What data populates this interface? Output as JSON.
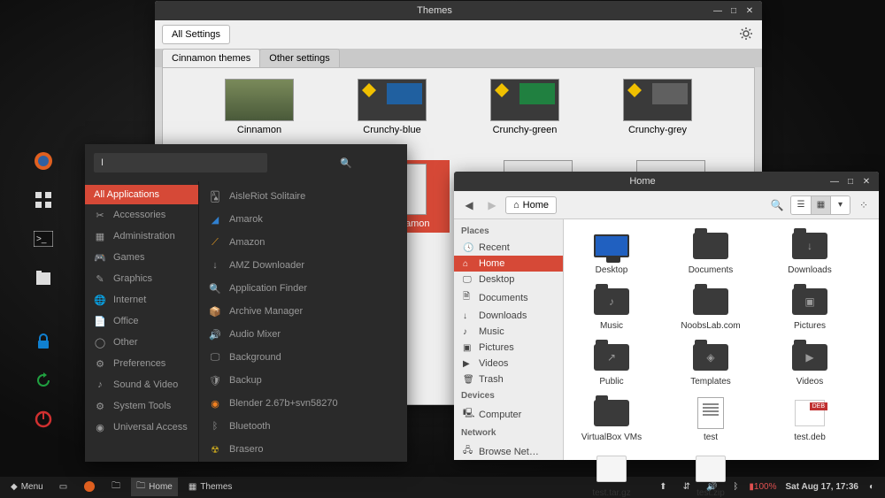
{
  "themes_window": {
    "title": "Themes",
    "all_settings": "All Settings",
    "tab_cinnamon": "Cinnamon themes",
    "tab_other": "Other settings",
    "items": [
      "Cinnamon",
      "Crunchy-blue",
      "Crunchy-green",
      "Crunchy-grey",
      "",
      "Numix-Cinnamon",
      "",
      ""
    ]
  },
  "menu": {
    "search_value": "I",
    "all_apps": "All Applications",
    "categories": [
      "Accessories",
      "Administration",
      "Games",
      "Graphics",
      "Internet",
      "Office",
      "Other",
      "Preferences",
      "Sound & Video",
      "System Tools",
      "Universal Access"
    ],
    "apps": [
      "AisleRiot Solitaire",
      "Amarok",
      "Amazon",
      "AMZ Downloader",
      "Application Finder",
      "Archive Manager",
      "Audio Mixer",
      "Background",
      "Backup",
      "Blender 2.67b+svn58270",
      "Bluetooth",
      "Brasero"
    ]
  },
  "fm": {
    "title": "Home",
    "path_label": "Home",
    "places_hdr": "Places",
    "devices_hdr": "Devices",
    "network_hdr": "Network",
    "places": [
      "Recent",
      "Home",
      "Desktop",
      "Documents",
      "Downloads",
      "Music",
      "Pictures",
      "Videos",
      "Trash"
    ],
    "devices": [
      "Computer"
    ],
    "network": [
      "Browse Net…"
    ],
    "files": [
      {
        "n": "Desktop",
        "t": "monitor"
      },
      {
        "n": "Documents",
        "t": "folder"
      },
      {
        "n": "Downloads",
        "t": "folder",
        "ov": "↓"
      },
      {
        "n": "Music",
        "t": "folder",
        "ov": "♪"
      },
      {
        "n": "NoobsLab.com",
        "t": "folder"
      },
      {
        "n": "Pictures",
        "t": "folder",
        "ov": "▣"
      },
      {
        "n": "Public",
        "t": "folder",
        "ov": "↗"
      },
      {
        "n": "Templates",
        "t": "folder",
        "ov": "◈"
      },
      {
        "n": "Videos",
        "t": "folder",
        "ov": "▶"
      },
      {
        "n": "VirtualBox VMs",
        "t": "folder"
      },
      {
        "n": "test",
        "t": "doc"
      },
      {
        "n": "test.deb",
        "t": "deb"
      },
      {
        "n": "test.tar.gz",
        "t": "pkg"
      },
      {
        "n": "test.zip",
        "t": "pkg"
      }
    ]
  },
  "panel": {
    "menu": "Menu",
    "task_home": "Home",
    "task_themes": "Themes",
    "battery": "100%",
    "datetime": "Sat Aug 17, 17:36"
  },
  "link": "v themes"
}
